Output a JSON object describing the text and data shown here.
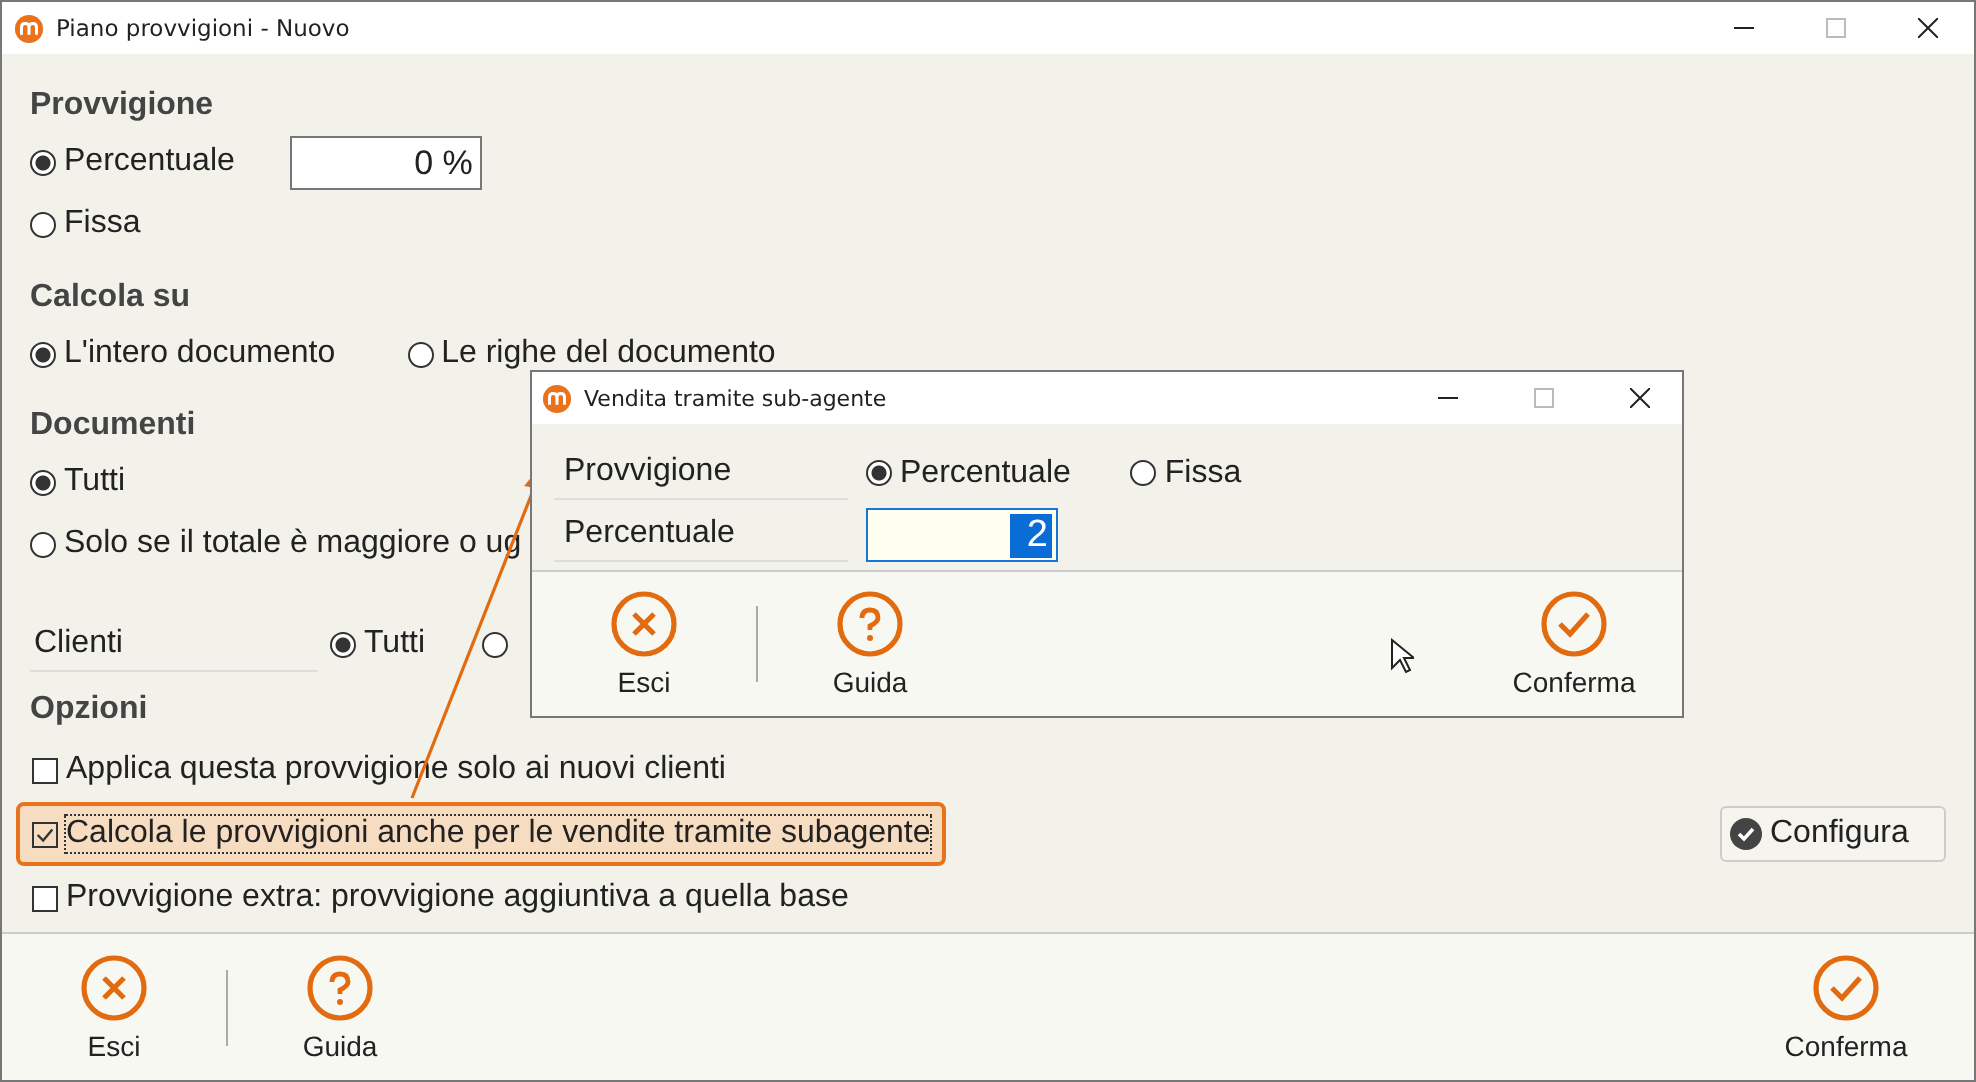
{
  "window": {
    "title": "Piano provvigioni - Nuovo"
  },
  "provvigione": {
    "heading": "Provvigione",
    "options": [
      {
        "label": "Percentuale",
        "selected": true
      },
      {
        "label": "Fissa",
        "selected": false
      }
    ],
    "value": "0 %"
  },
  "calcola_su": {
    "heading": "Calcola su",
    "options": [
      {
        "label": "L'intero documento",
        "selected": true
      },
      {
        "label": "Le righe del documento",
        "selected": false
      }
    ]
  },
  "documenti": {
    "heading": "Documenti",
    "options": [
      {
        "label": "Tutti",
        "selected": true
      },
      {
        "label": "Solo se il totale è maggiore o ug",
        "selected": false
      }
    ]
  },
  "clienti": {
    "label": "Clienti",
    "options": [
      {
        "label": "Tutti",
        "selected": true
      },
      {
        "selected": false
      }
    ]
  },
  "opzioni": {
    "heading": "Opzioni",
    "items": [
      {
        "label": "Applica questa provvigione solo ai nuovi clienti",
        "checked": false,
        "highlighted": false
      },
      {
        "label": "Calcola le provvigioni anche per le vendite tramite subagente",
        "checked": true,
        "highlighted": true
      },
      {
        "label": "Provvigione extra: provvigione aggiuntiva a quella base",
        "checked": false,
        "highlighted": false
      }
    ],
    "configure_button": "Configura"
  },
  "footer": [
    {
      "kind": "close",
      "label": "Esci"
    },
    {
      "kind": "help",
      "label": "Guida"
    },
    {
      "kind": "confirm",
      "label": "Conferma"
    }
  ],
  "dialog": {
    "title": "Vendita tramite sub-agente",
    "rows": [
      {
        "label": "Provvigione"
      },
      {
        "label": "Percentuale"
      }
    ],
    "options": [
      {
        "label": "Percentuale",
        "selected": true
      },
      {
        "label": "Fissa",
        "selected": false
      }
    ],
    "value": "2",
    "footer": [
      {
        "kind": "close",
        "label": "Esci"
      },
      {
        "kind": "help",
        "label": "Guida"
      },
      {
        "kind": "confirm",
        "label": "Conferma"
      }
    ]
  }
}
